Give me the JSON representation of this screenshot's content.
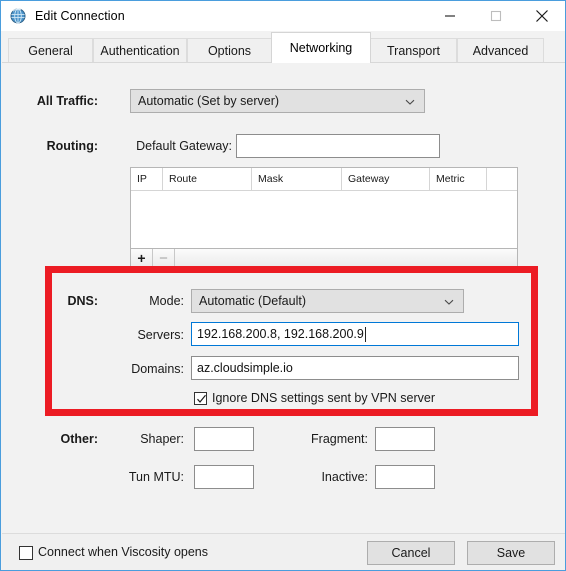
{
  "window": {
    "title": "Edit Connection",
    "icon": "globe-icon",
    "controls": {
      "minimize": "minimize-icon",
      "maximize": "maximize-icon",
      "close": "close-icon"
    },
    "accent_color": "#4a9ddd"
  },
  "tabs": [
    {
      "label": "General",
      "active": false
    },
    {
      "label": "Authentication",
      "active": false
    },
    {
      "label": "Options",
      "active": false
    },
    {
      "label": "Networking",
      "active": true
    },
    {
      "label": "Transport",
      "active": false
    },
    {
      "label": "Advanced",
      "active": false
    }
  ],
  "all_traffic": {
    "label": "All Traffic:",
    "value": "Automatic (Set by server)",
    "chevron": "chevron-down-icon"
  },
  "routing": {
    "label": "Routing:",
    "gateway_label": "Default Gateway:",
    "gateway_value": "",
    "gateway_placeholder": "",
    "columns": [
      "IP",
      "Route",
      "Mask",
      "Gateway",
      "Metric"
    ],
    "rows": [],
    "add_button": "+",
    "remove_button": "−"
  },
  "dns": {
    "label": "DNS:",
    "mode_label": "Mode:",
    "mode_value": "Automatic (Default)",
    "mode_chevron": "chevron-down-icon",
    "servers_label": "Servers:",
    "servers_value": "192.168.200.8, 192.168.200.9",
    "servers_focused": true,
    "domains_label": "Domains:",
    "domains_value": "az.cloudsimple.io",
    "ignore_label": "Ignore DNS settings sent by VPN server",
    "ignore_checked": true,
    "highlight_color": "#ec1c24"
  },
  "other": {
    "label": "Other:",
    "shaper_label": "Shaper:",
    "shaper_value": "",
    "fragment_label": "Fragment:",
    "fragment_value": "",
    "tun_mtu_label": "Tun MTU:",
    "tun_mtu_value": "",
    "inactive_label": "Inactive:",
    "inactive_value": ""
  },
  "footer": {
    "connect_label": "Connect when Viscosity opens",
    "connect_checked": false,
    "cancel_label": "Cancel",
    "save_label": "Save"
  }
}
